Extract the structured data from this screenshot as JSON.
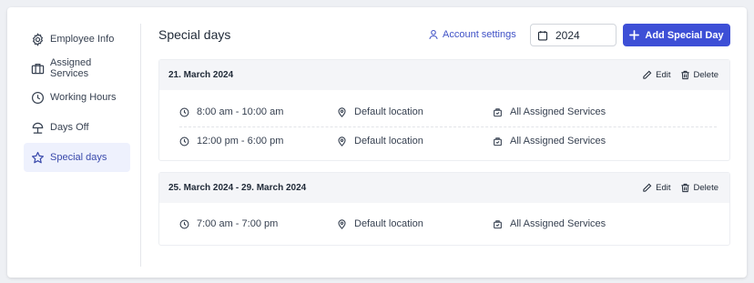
{
  "sidebar": {
    "items": [
      {
        "label": "Employee Info",
        "icon": "gear-icon"
      },
      {
        "label": "Assigned Services",
        "icon": "briefcase-icon"
      },
      {
        "label": "Working Hours",
        "icon": "clock-icon"
      },
      {
        "label": "Days Off",
        "icon": "beach-umbrella-icon"
      },
      {
        "label": "Special days",
        "icon": "star-icon",
        "active": true
      }
    ]
  },
  "header": {
    "title": "Special days",
    "account_settings": "Account settings",
    "year": "2024",
    "add_button": "Add Special Day"
  },
  "actions": {
    "edit": "Edit",
    "delete": "Delete"
  },
  "special_days": [
    {
      "date": "21. March 2024",
      "slots": [
        {
          "time": "8:00 am - 10:00 am",
          "location": "Default location",
          "services": "All Assigned Services"
        },
        {
          "time": "12:00 pm - 6:00 pm",
          "location": "Default location",
          "services": "All Assigned Services"
        }
      ]
    },
    {
      "date": "25. March 2024 - 29. March 2024",
      "slots": [
        {
          "time": "7:00 am - 7:00 pm",
          "location": "Default location",
          "services": "All Assigned Services"
        }
      ]
    }
  ],
  "colors": {
    "accent": "#3d4fd6",
    "active_bg": "#eef1fd",
    "header_bg": "#f4f5f8"
  }
}
